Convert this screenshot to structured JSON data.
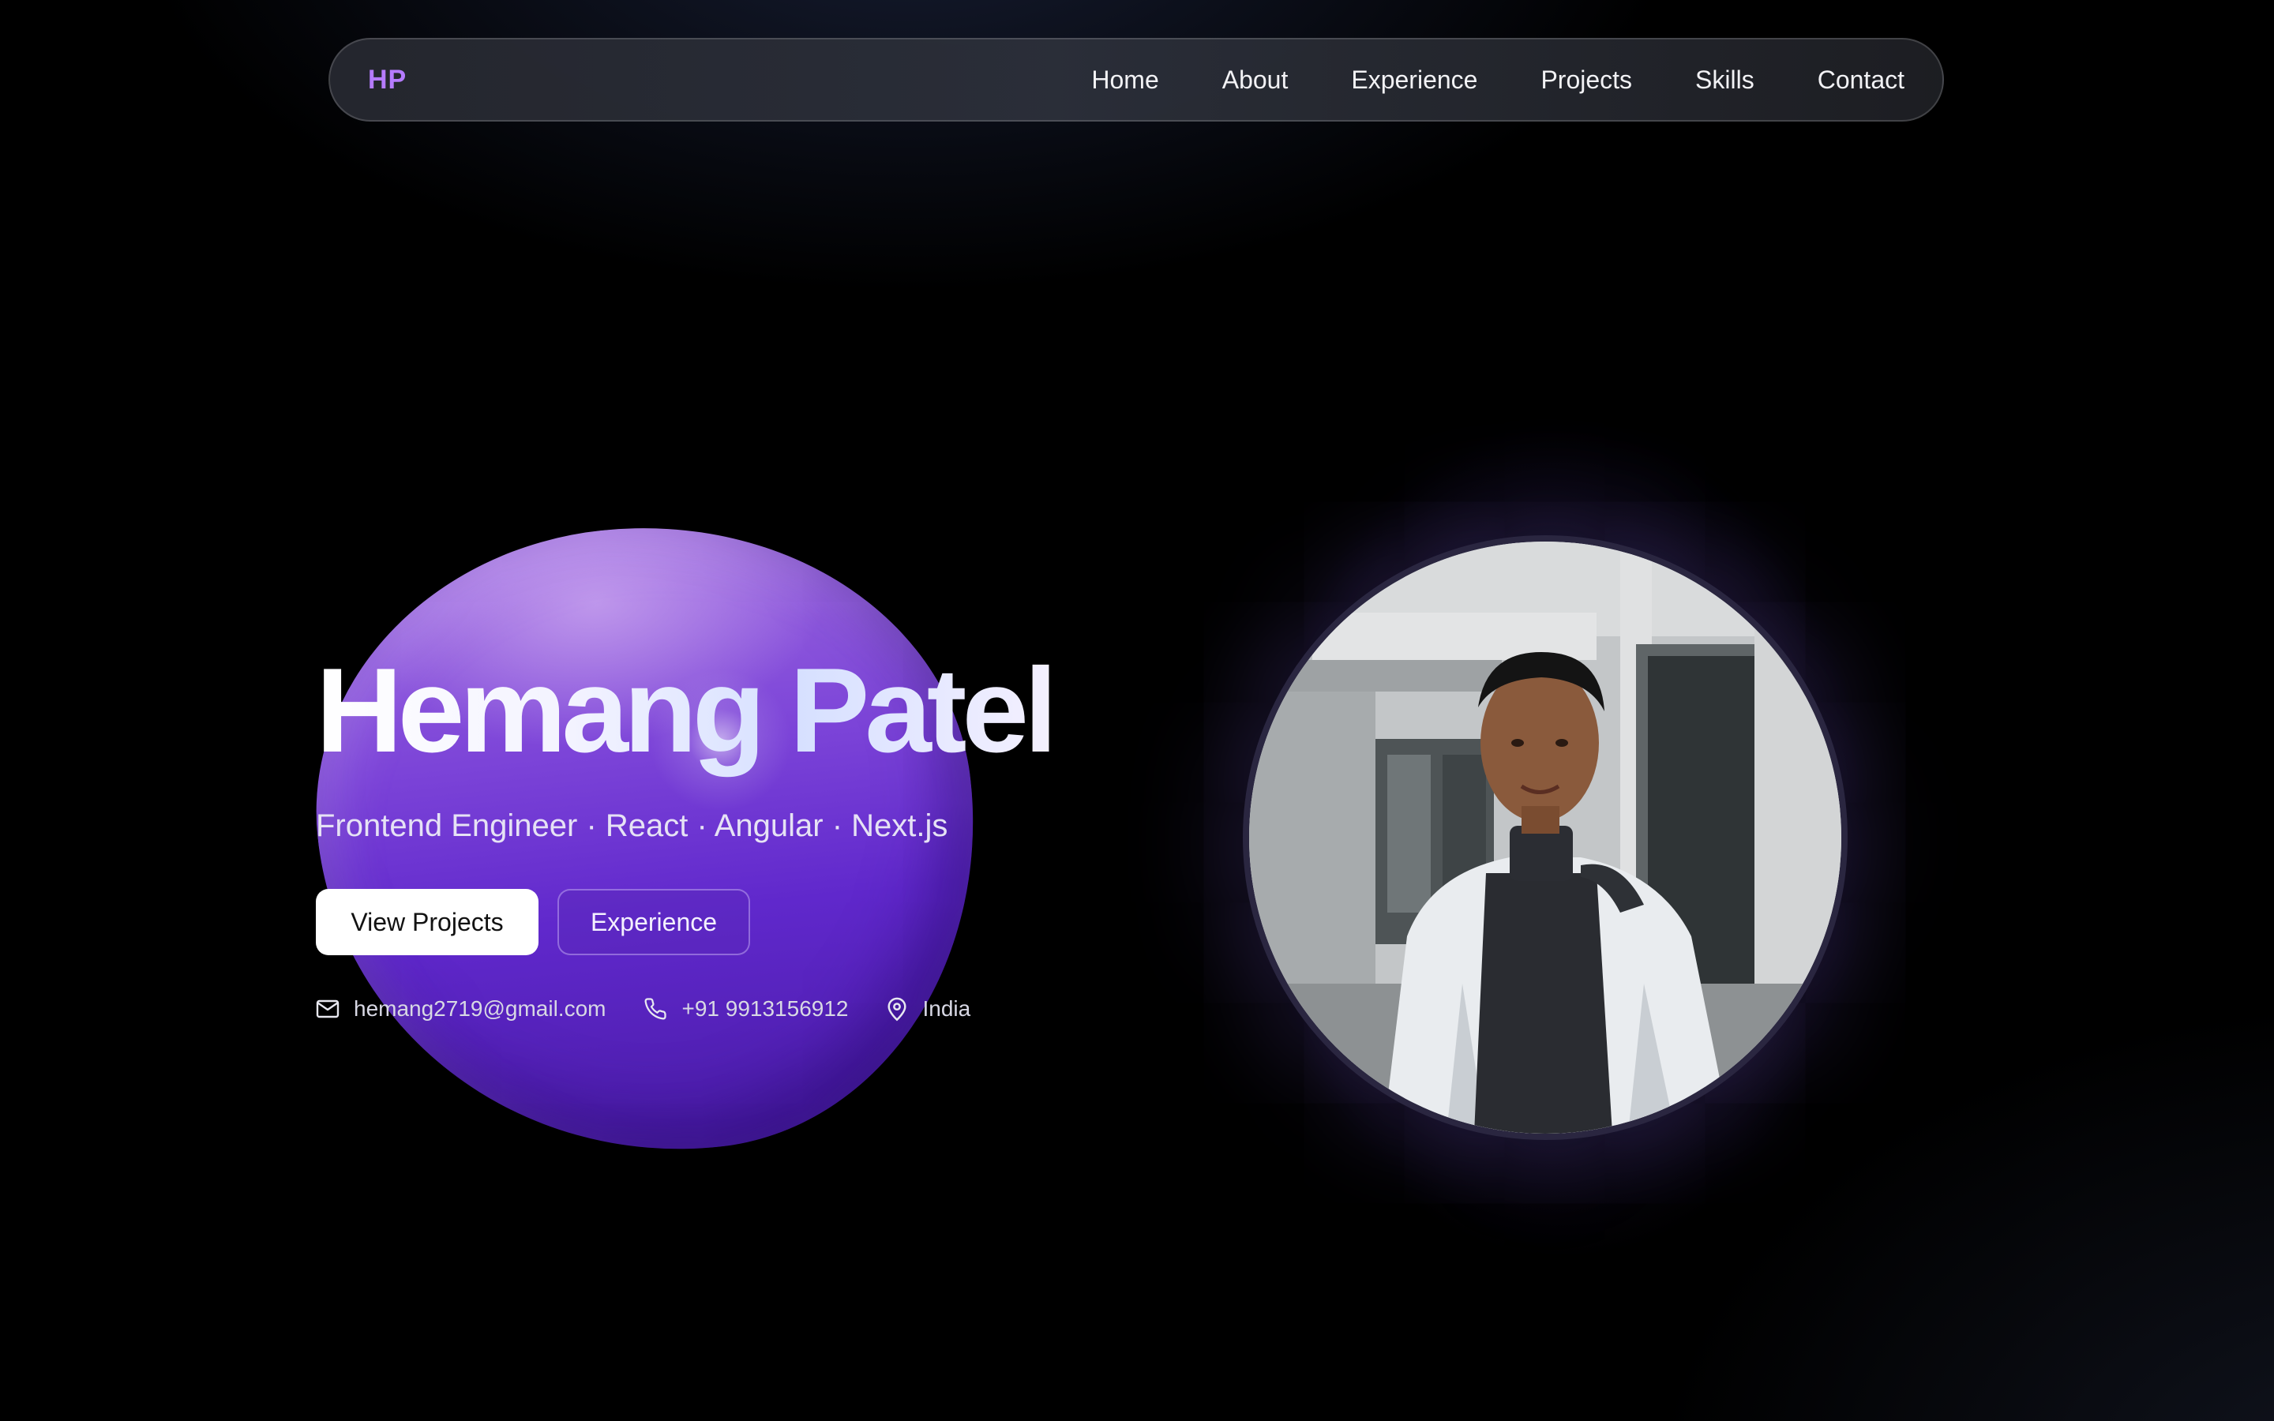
{
  "nav": {
    "brand": "HP",
    "links": [
      "Home",
      "About",
      "Experience",
      "Projects",
      "Skills",
      "Contact"
    ]
  },
  "hero": {
    "name": "Hemang Patel",
    "subtitle": "Frontend Engineer · React · Angular · Next.js",
    "primary_button": "View Projects",
    "secondary_button": "Experience"
  },
  "contact": {
    "email": "hemang2719@gmail.com",
    "phone": "+91 9913156912",
    "location": "India"
  },
  "icons": {
    "email": "mail-icon",
    "phone": "phone-icon",
    "location": "map-pin-icon"
  },
  "colors": {
    "brand": "#b57bff",
    "blob": "#6a30d0",
    "primary_button_bg": "#ffffff"
  }
}
